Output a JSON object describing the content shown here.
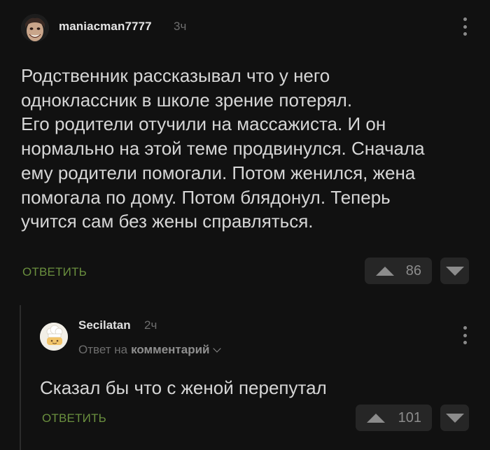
{
  "comments": [
    {
      "author": "maniacman7777",
      "time": "3ч",
      "text": "Родственник рассказывал что у него\nодноклассник в школе зрение потерял.\nЕго родители отучили на массажиста. И он\nнормально на этой теме продвинулся. Сначала\nему родители помогали. Потом женился, жена\nпомогала по дому. Потом блядонул. Теперь\nучится сам без жены справляться.",
      "reply_label": "ОТВЕТИТЬ",
      "rating": "86"
    },
    {
      "author": "Secilatan",
      "time": "2ч",
      "reply_to_prefix": "Ответ на",
      "reply_to_target": "комментарий",
      "text": "Сказал бы что с женой перепутал",
      "reply_label": "ОТВЕТИТЬ",
      "rating": "101"
    }
  ],
  "colors": {
    "background": "#111111",
    "reply_link": "#6a8f3e",
    "vote_box": "#262626",
    "muted_text": "#6e6e6e"
  },
  "icons": {
    "vote_up": "triangle-up-icon",
    "vote_down": "triangle-down-icon",
    "more": "vertical-dots-icon",
    "expand": "chevron-down-icon"
  }
}
